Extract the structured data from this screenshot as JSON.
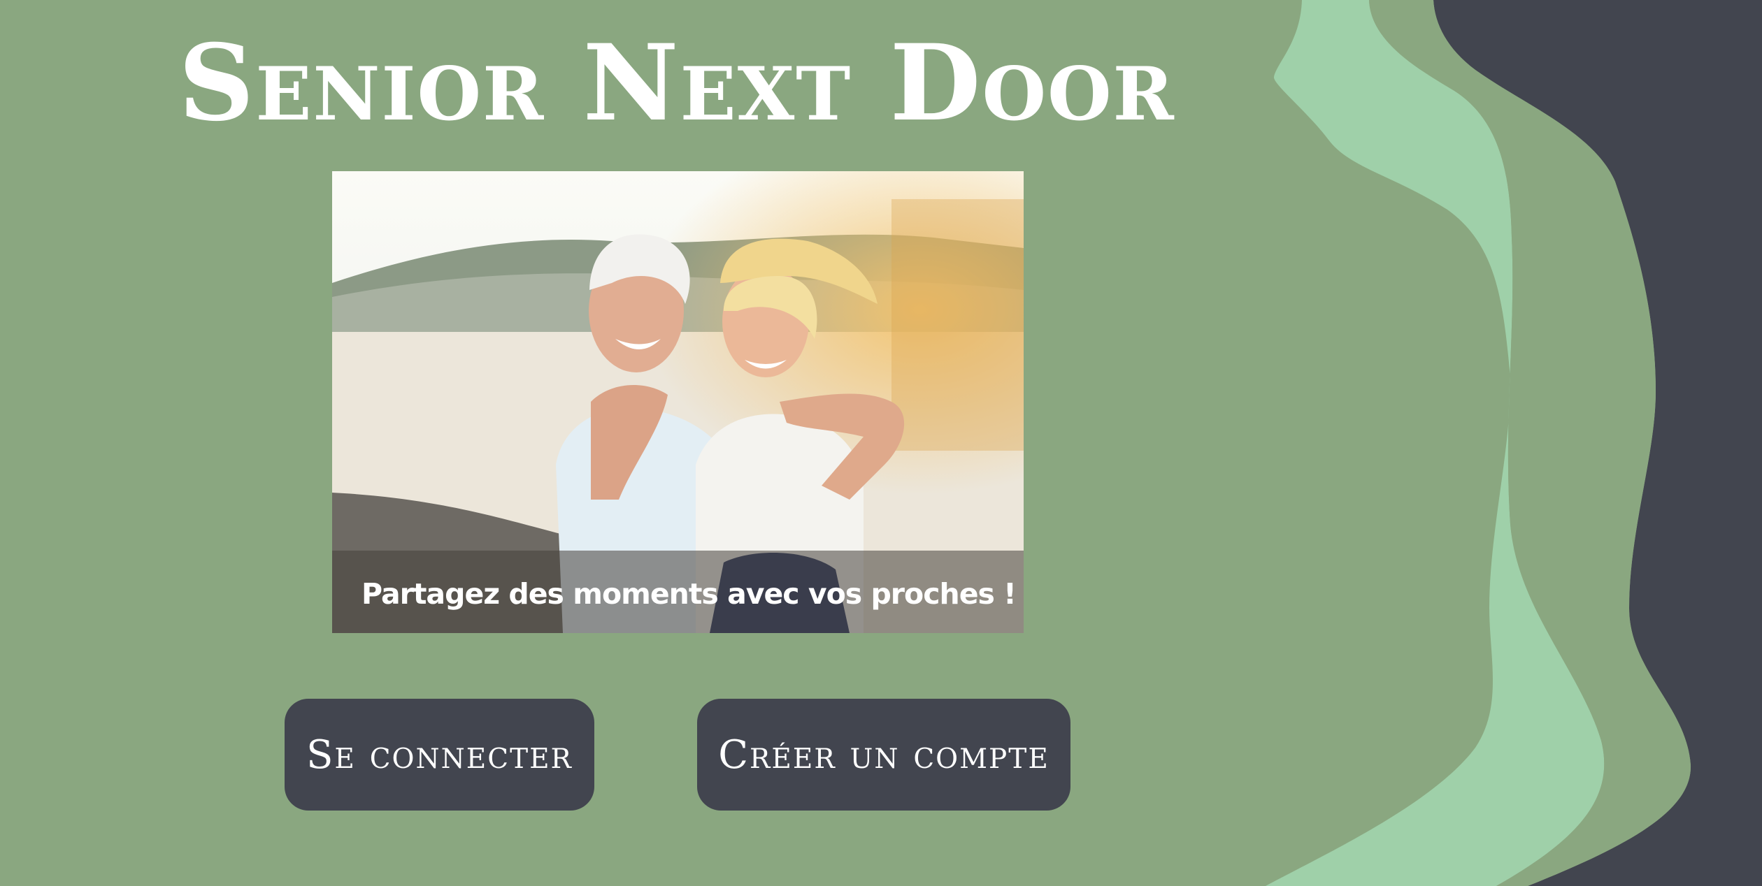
{
  "app": {
    "title": "Senior Next Door"
  },
  "hero": {
    "caption": "Partagez des moments avec vos proches !",
    "image_subject": "couple-laughing-photo"
  },
  "actions": {
    "login_label": "Se connecter",
    "signup_label": "Créer un compte"
  },
  "colors": {
    "background": "#8aa780",
    "wave_light": "#9fd0a9",
    "dark_panel": "#42454f",
    "button_bg": "#42454f",
    "text": "#ffffff"
  }
}
